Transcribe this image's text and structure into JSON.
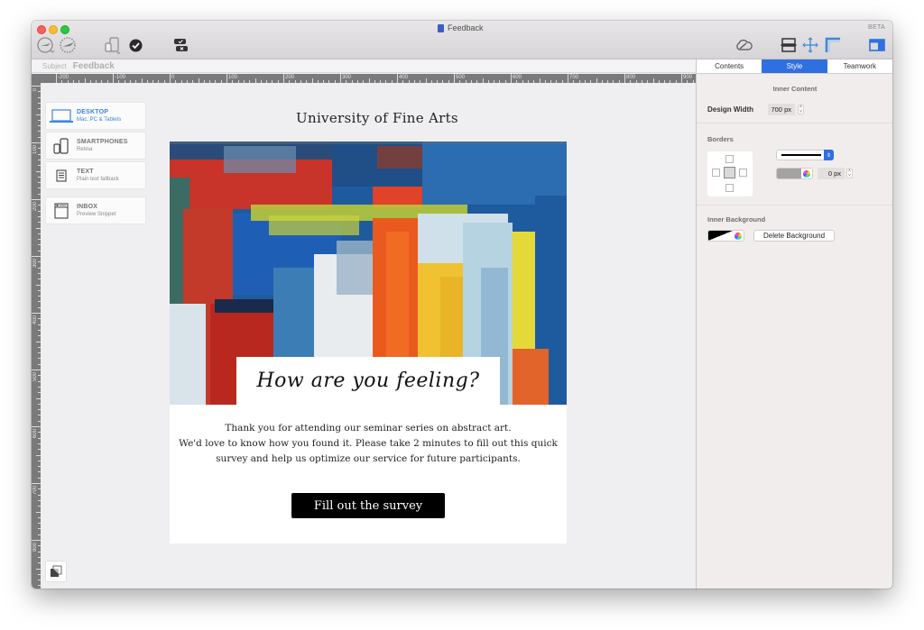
{
  "window": {
    "title": "Feedback",
    "beta_label": "BETA",
    "toolbar_icons": [
      "send-test-icon",
      "send-campaign-icon",
      "device-preview-icon",
      "check-icon",
      "comments-icon",
      "cloud-sync-icon",
      "layout-blocks-icon",
      "move-icon",
      "ruler-guide-icon",
      "sidebar-toggle-icon"
    ]
  },
  "subject": {
    "label": "Subject",
    "value": "Feedback"
  },
  "ruler": {
    "horizontal_labels": [
      "-200",
      "-100",
      "0",
      "100",
      "200",
      "300",
      "400",
      "500",
      "600",
      "700",
      "800",
      "900"
    ],
    "vertical_labels": [
      "0",
      "100",
      "200",
      "300",
      "400",
      "500",
      "600",
      "700",
      "800"
    ]
  },
  "devices": [
    {
      "title": "DESKTOP",
      "subtitle": "Mac, PC & Tablets",
      "icon": "laptop-icon",
      "active": true
    },
    {
      "title": "SMARTPHONES",
      "subtitle": "Retina",
      "icon": "smartphone-icon",
      "active": false
    },
    {
      "title": "TEXT",
      "subtitle": "Plain text fallback",
      "icon": "text-document-icon",
      "active": false
    },
    {
      "title": "INBOX",
      "subtitle": "Preview Snippet",
      "icon": "inbox-window-icon",
      "active": false
    }
  ],
  "email": {
    "header_title": "University of Fine Arts",
    "hero_heading": "How are you feeling?",
    "body_lines": [
      "Thank you for attending our seminar series on abstract art.",
      "We'd love to know how you found it. Please take 2 minutes to fill out this quick",
      "survey and help us optimize our service for future participants."
    ],
    "cta_label": "Fill out the survey"
  },
  "panel": {
    "tabs": [
      {
        "label": "Contents",
        "active": false
      },
      {
        "label": "Style",
        "active": true
      },
      {
        "label": "Teamwork",
        "active": false
      }
    ],
    "inner_content_title": "Inner Content",
    "design_width_label": "Design Width",
    "design_width_value": "700 px",
    "borders_title": "Borders",
    "border_width_value": "0 px",
    "border_color": "#a3a3a3",
    "inner_background_title": "Inner Background",
    "delete_background_label": "Delete Background"
  },
  "colors": {
    "accent": "#2f6fe0",
    "device_active": "#3d86dd",
    "cta_background": "#000000"
  }
}
